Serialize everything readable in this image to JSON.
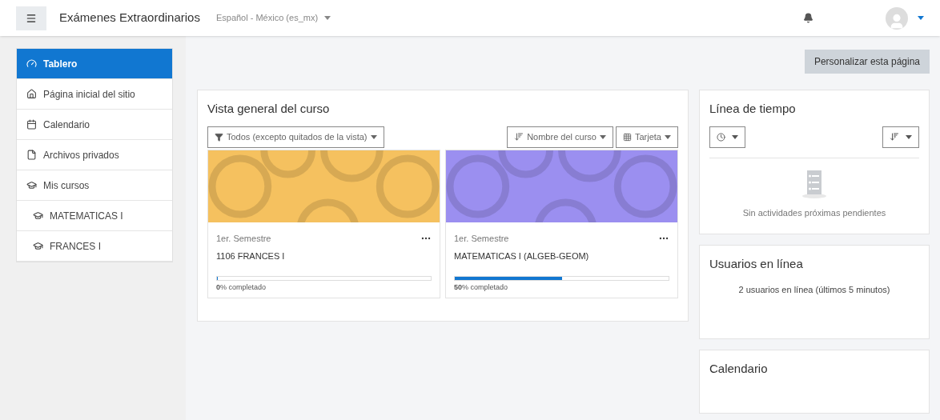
{
  "navbar": {
    "site_name": "Exámenes Extraordinarios",
    "language": "Español - México (es_mx)"
  },
  "sidebar": {
    "items": [
      {
        "label": "Tablero",
        "selected": true
      },
      {
        "label": "Página inicial del sitio",
        "selected": false
      },
      {
        "label": "Calendario",
        "selected": false
      },
      {
        "label": "Archivos privados",
        "selected": false
      },
      {
        "label": "Mis cursos",
        "selected": false,
        "children": [
          {
            "label": "MATEMATICAS I",
            "selected": false
          },
          {
            "label": "FRANCES I",
            "selected": false
          }
        ]
      }
    ]
  },
  "customize_button": "Personalizar esta página",
  "course_overview": {
    "title": "Vista general del curso",
    "filter": "Todos (excepto quitados de la vista)",
    "sort": "Nombre del curso",
    "view": "Tarjeta",
    "courses": [
      {
        "category": "1er. Semestre",
        "name": "1106 FRANCES I",
        "color": "#f5c15f",
        "level": 0,
        "progress_text": "**0**% completado"
      },
      {
        "category": "1er. Semestre",
        "name": "MATEMATICAS I (ALGEB-GEOM)",
        "color": "#9b8ff0",
        "level": 0.5,
        "progress_text": "**50**% completado"
      }
    ]
  },
  "timeline": {
    "title": "Línea de tiempo",
    "empty_text": "Sin actividades próximas pendientes"
  },
  "online_users": {
    "title": "Usuarios en línea",
    "text": "2 usuarios en línea (últimos 5 minutos)"
  },
  "calendar": {
    "title": "Calendario"
  }
}
